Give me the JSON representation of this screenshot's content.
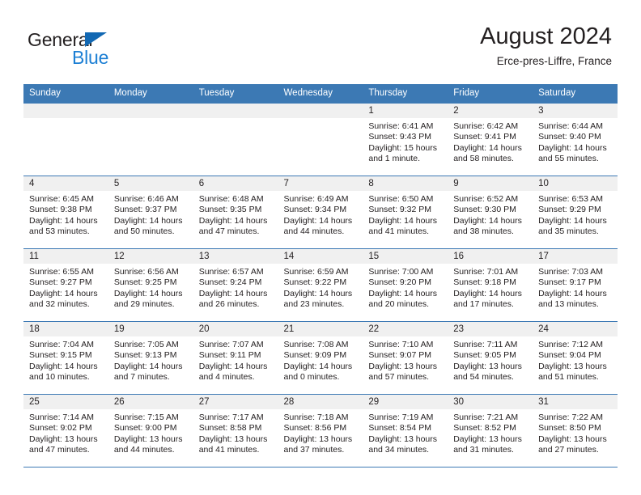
{
  "brand": {
    "name_part1": "General",
    "name_part2": "Blue",
    "triangle_color": "#1268b3",
    "blue_color": "#1c7fd4"
  },
  "header": {
    "title": "August 2024",
    "subtitle": "Erce-pres-Liffre, France"
  },
  "theme": {
    "header_row_bg": "#3c79b4",
    "daynum_band_bg": "#f0f0f0",
    "text_color": "#231f20"
  },
  "weekdays": [
    "Sunday",
    "Monday",
    "Tuesday",
    "Wednesday",
    "Thursday",
    "Friday",
    "Saturday"
  ],
  "labels": {
    "sunrise_prefix": "Sunrise:",
    "sunset_prefix": "Sunset:",
    "daylight_prefix": "Daylight:"
  },
  "weeks": [
    [
      {
        "day": "",
        "empty": true
      },
      {
        "day": "",
        "empty": true
      },
      {
        "day": "",
        "empty": true
      },
      {
        "day": "",
        "empty": true
      },
      {
        "day": "1",
        "sunrise": "Sunrise: 6:41 AM",
        "sunset": "Sunset: 9:43 PM",
        "daylight_line1": "Daylight: 15 hours",
        "daylight_line2": "and 1 minute."
      },
      {
        "day": "2",
        "sunrise": "Sunrise: 6:42 AM",
        "sunset": "Sunset: 9:41 PM",
        "daylight_line1": "Daylight: 14 hours",
        "daylight_line2": "and 58 minutes."
      },
      {
        "day": "3",
        "sunrise": "Sunrise: 6:44 AM",
        "sunset": "Sunset: 9:40 PM",
        "daylight_line1": "Daylight: 14 hours",
        "daylight_line2": "and 55 minutes."
      }
    ],
    [
      {
        "day": "4",
        "sunrise": "Sunrise: 6:45 AM",
        "sunset": "Sunset: 9:38 PM",
        "daylight_line1": "Daylight: 14 hours",
        "daylight_line2": "and 53 minutes."
      },
      {
        "day": "5",
        "sunrise": "Sunrise: 6:46 AM",
        "sunset": "Sunset: 9:37 PM",
        "daylight_line1": "Daylight: 14 hours",
        "daylight_line2": "and 50 minutes."
      },
      {
        "day": "6",
        "sunrise": "Sunrise: 6:48 AM",
        "sunset": "Sunset: 9:35 PM",
        "daylight_line1": "Daylight: 14 hours",
        "daylight_line2": "and 47 minutes."
      },
      {
        "day": "7",
        "sunrise": "Sunrise: 6:49 AM",
        "sunset": "Sunset: 9:34 PM",
        "daylight_line1": "Daylight: 14 hours",
        "daylight_line2": "and 44 minutes."
      },
      {
        "day": "8",
        "sunrise": "Sunrise: 6:50 AM",
        "sunset": "Sunset: 9:32 PM",
        "daylight_line1": "Daylight: 14 hours",
        "daylight_line2": "and 41 minutes."
      },
      {
        "day": "9",
        "sunrise": "Sunrise: 6:52 AM",
        "sunset": "Sunset: 9:30 PM",
        "daylight_line1": "Daylight: 14 hours",
        "daylight_line2": "and 38 minutes."
      },
      {
        "day": "10",
        "sunrise": "Sunrise: 6:53 AM",
        "sunset": "Sunset: 9:29 PM",
        "daylight_line1": "Daylight: 14 hours",
        "daylight_line2": "and 35 minutes."
      }
    ],
    [
      {
        "day": "11",
        "sunrise": "Sunrise: 6:55 AM",
        "sunset": "Sunset: 9:27 PM",
        "daylight_line1": "Daylight: 14 hours",
        "daylight_line2": "and 32 minutes."
      },
      {
        "day": "12",
        "sunrise": "Sunrise: 6:56 AM",
        "sunset": "Sunset: 9:25 PM",
        "daylight_line1": "Daylight: 14 hours",
        "daylight_line2": "and 29 minutes."
      },
      {
        "day": "13",
        "sunrise": "Sunrise: 6:57 AM",
        "sunset": "Sunset: 9:24 PM",
        "daylight_line1": "Daylight: 14 hours",
        "daylight_line2": "and 26 minutes."
      },
      {
        "day": "14",
        "sunrise": "Sunrise: 6:59 AM",
        "sunset": "Sunset: 9:22 PM",
        "daylight_line1": "Daylight: 14 hours",
        "daylight_line2": "and 23 minutes."
      },
      {
        "day": "15",
        "sunrise": "Sunrise: 7:00 AM",
        "sunset": "Sunset: 9:20 PM",
        "daylight_line1": "Daylight: 14 hours",
        "daylight_line2": "and 20 minutes."
      },
      {
        "day": "16",
        "sunrise": "Sunrise: 7:01 AM",
        "sunset": "Sunset: 9:18 PM",
        "daylight_line1": "Daylight: 14 hours",
        "daylight_line2": "and 17 minutes."
      },
      {
        "day": "17",
        "sunrise": "Sunrise: 7:03 AM",
        "sunset": "Sunset: 9:17 PM",
        "daylight_line1": "Daylight: 14 hours",
        "daylight_line2": "and 13 minutes."
      }
    ],
    [
      {
        "day": "18",
        "sunrise": "Sunrise: 7:04 AM",
        "sunset": "Sunset: 9:15 PM",
        "daylight_line1": "Daylight: 14 hours",
        "daylight_line2": "and 10 minutes."
      },
      {
        "day": "19",
        "sunrise": "Sunrise: 7:05 AM",
        "sunset": "Sunset: 9:13 PM",
        "daylight_line1": "Daylight: 14 hours",
        "daylight_line2": "and 7 minutes."
      },
      {
        "day": "20",
        "sunrise": "Sunrise: 7:07 AM",
        "sunset": "Sunset: 9:11 PM",
        "daylight_line1": "Daylight: 14 hours",
        "daylight_line2": "and 4 minutes."
      },
      {
        "day": "21",
        "sunrise": "Sunrise: 7:08 AM",
        "sunset": "Sunset: 9:09 PM",
        "daylight_line1": "Daylight: 14 hours",
        "daylight_line2": "and 0 minutes."
      },
      {
        "day": "22",
        "sunrise": "Sunrise: 7:10 AM",
        "sunset": "Sunset: 9:07 PM",
        "daylight_line1": "Daylight: 13 hours",
        "daylight_line2": "and 57 minutes."
      },
      {
        "day": "23",
        "sunrise": "Sunrise: 7:11 AM",
        "sunset": "Sunset: 9:05 PM",
        "daylight_line1": "Daylight: 13 hours",
        "daylight_line2": "and 54 minutes."
      },
      {
        "day": "24",
        "sunrise": "Sunrise: 7:12 AM",
        "sunset": "Sunset: 9:04 PM",
        "daylight_line1": "Daylight: 13 hours",
        "daylight_line2": "and 51 minutes."
      }
    ],
    [
      {
        "day": "25",
        "sunrise": "Sunrise: 7:14 AM",
        "sunset": "Sunset: 9:02 PM",
        "daylight_line1": "Daylight: 13 hours",
        "daylight_line2": "and 47 minutes."
      },
      {
        "day": "26",
        "sunrise": "Sunrise: 7:15 AM",
        "sunset": "Sunset: 9:00 PM",
        "daylight_line1": "Daylight: 13 hours",
        "daylight_line2": "and 44 minutes."
      },
      {
        "day": "27",
        "sunrise": "Sunrise: 7:17 AM",
        "sunset": "Sunset: 8:58 PM",
        "daylight_line1": "Daylight: 13 hours",
        "daylight_line2": "and 41 minutes."
      },
      {
        "day": "28",
        "sunrise": "Sunrise: 7:18 AM",
        "sunset": "Sunset: 8:56 PM",
        "daylight_line1": "Daylight: 13 hours",
        "daylight_line2": "and 37 minutes."
      },
      {
        "day": "29",
        "sunrise": "Sunrise: 7:19 AM",
        "sunset": "Sunset: 8:54 PM",
        "daylight_line1": "Daylight: 13 hours",
        "daylight_line2": "and 34 minutes."
      },
      {
        "day": "30",
        "sunrise": "Sunrise: 7:21 AM",
        "sunset": "Sunset: 8:52 PM",
        "daylight_line1": "Daylight: 13 hours",
        "daylight_line2": "and 31 minutes."
      },
      {
        "day": "31",
        "sunrise": "Sunrise: 7:22 AM",
        "sunset": "Sunset: 8:50 PM",
        "daylight_line1": "Daylight: 13 hours",
        "daylight_line2": "and 27 minutes."
      }
    ]
  ]
}
